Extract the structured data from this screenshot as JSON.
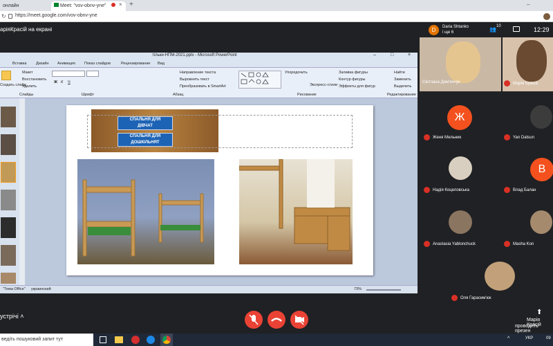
{
  "browser": {
    "tab_left": "онлайн",
    "tab_active": "Meet: \"vov-obnv-yne\"",
    "url": "https://meet.google.com/vov-obnv-yne"
  },
  "meet": {
    "presenting_banner": "аріяКрасій на екрані",
    "presenter_name": "Daria Shtanko",
    "presenter_more": "і ще 6",
    "participants_count": "10",
    "clock": "12:29",
    "bottom_left": "устрічі",
    "bottom_right_name": "Марія Красій",
    "bottom_right_text": "проводить презен"
  },
  "ppt": {
    "title": "тільки-НПМ-2021.pptx - Microsoft PowerPoint",
    "tabs": [
      "Вставка",
      "Дизайн",
      "Анимация",
      "Показ слайдов",
      "Рецензирование",
      "Вид"
    ],
    "groups": {
      "slides": [
        "Макет",
        "Восстановить",
        "Удалить"
      ],
      "create_slide": "Создать слайд",
      "slides_label": "Слайды",
      "font_label": "Шрифт",
      "para_label": "Абзац",
      "draw_label": "Рисование",
      "edit_label": "Редактирование",
      "para_items": [
        "Направление текста",
        "Выровнять текст",
        "Преобразовать в SmartArt"
      ],
      "draw_items": [
        "Упорядочить",
        "Экспресс-стили",
        "Заливка фигуры",
        "Контур фигуры",
        "Эффекты для фигур"
      ],
      "edit_items": [
        "Найти",
        "Заменить",
        "Выделить"
      ]
    },
    "status_theme": "\"Тема Office\"",
    "status_lang": "украинский",
    "zoom": "73%",
    "sign_line1": "СПАЛЬНЯ ДЛЯ",
    "sign_line2": "ДІВЧАТ",
    "sign_line3": "СПАЛЬНЯ ДЛЯ",
    "sign_line4": "ДОШКІЛЬНЯТ"
  },
  "participants": [
    {
      "name": "Світлана Дем'янчук",
      "muted": false
    },
    {
      "name": "Марія Красій",
      "muted": true
    },
    {
      "name": "Женя Мельник",
      "muted": true,
      "initial": "Ж",
      "color": "#f4511e"
    },
    {
      "name": "Yan Datsun",
      "muted": true
    },
    {
      "name": "Надія Коцеловська",
      "muted": true
    },
    {
      "name": "Влад Балан",
      "muted": true,
      "initial": "В",
      "color": "#f4511e"
    },
    {
      "name": "Anastasia Yablonchuck",
      "muted": true
    },
    {
      "name": "Masha Kon",
      "muted": true
    },
    {
      "name": "Оля Гарасим'юк",
      "muted": true
    }
  ],
  "taskbar": {
    "search": "ведіть пошуковий запит тут",
    "lang": "УКР",
    "time": "09"
  }
}
